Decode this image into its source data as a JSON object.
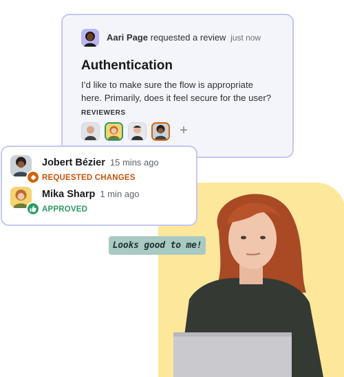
{
  "review_request": {
    "requester_name": "Aari Page",
    "action_text": "requested a review",
    "time": "just now",
    "title": "Authentication",
    "body": "I’d like to make sure the flow is appropriate here. Primarily, does it feel secure for the user?",
    "reviewers_label": "REVIEWERS",
    "add_reviewer_symbol": "+"
  },
  "reviews": [
    {
      "name": "Jobert Bézier",
      "time": "15 mins ago",
      "status": "REQUESTED CHANGES",
      "status_color": "#c6560a",
      "badge_icon": "diamond-icon"
    },
    {
      "name": "Mika Sharp",
      "time": "1 min ago",
      "status": "APPROVED",
      "status_color": "#2c9b64",
      "badge_icon": "thumbs-up-icon"
    }
  ],
  "speech": {
    "text": "Looks good to me!"
  },
  "colors": {
    "card_border": "#c4c6f1",
    "card_bg": "#f4f4fb",
    "yellow_bg": "#fde79b",
    "speech_bg": "#a9c9c3"
  }
}
